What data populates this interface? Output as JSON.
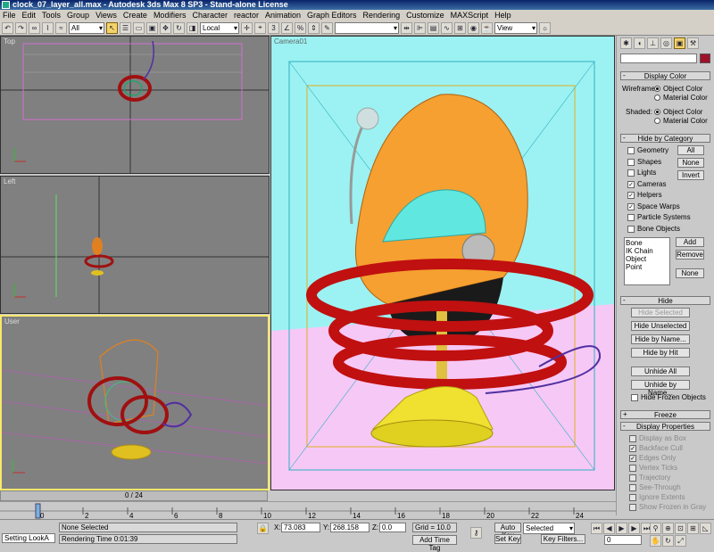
{
  "window": {
    "title": "clock_07_layer_all.max - Autodesk 3ds Max 8 SP3  - Stand-alone License"
  },
  "menu": [
    "File",
    "Edit",
    "Tools",
    "Group",
    "Views",
    "Create",
    "Modifiers",
    "Character",
    "reactor",
    "Animation",
    "Graph Editors",
    "Rendering",
    "Customize",
    "MAXScript",
    "Help"
  ],
  "toolbar": {
    "selection_filter": "All",
    "coord_system": "Local",
    "view_dropdown": "View"
  },
  "viewports": {
    "top": "Top",
    "left": "Left",
    "user": "User",
    "camera": "Camera01"
  },
  "command_panel": {
    "display_color": {
      "header": "Display Color",
      "wireframe_label": "Wireframe:",
      "shaded_label": "Shaded:",
      "object_color": "Object Color",
      "material_color": "Material Color"
    },
    "hide_by_category": {
      "header": "Hide by Category",
      "items": [
        {
          "label": "Geometry",
          "checked": false
        },
        {
          "label": "Shapes",
          "checked": false
        },
        {
          "label": "Lights",
          "checked": false
        },
        {
          "label": "Cameras",
          "checked": true
        },
        {
          "label": "Helpers",
          "checked": true
        },
        {
          "label": "Space Warps",
          "checked": true
        },
        {
          "label": "Particle Systems",
          "checked": false
        },
        {
          "label": "Bone Objects",
          "checked": false
        }
      ],
      "all": "All",
      "none": "None",
      "invert": "Invert",
      "list": [
        "Bone",
        "IK Chain Object",
        "Point"
      ],
      "add": "Add",
      "remove": "Remove",
      "none2": "None"
    },
    "hide": {
      "header": "Hide",
      "hide_selected": "Hide Selected",
      "hide_unselected": "Hide Unselected",
      "hide_by_name": "Hide by Name...",
      "hide_by_hit": "Hide by Hit",
      "unhide_all": "Unhide All",
      "unhide_by_name": "Unhide by Name...",
      "hide_frozen": "Hide Frozen Objects"
    },
    "freeze": {
      "header": "Freeze"
    },
    "display_properties": {
      "header": "Display Properties",
      "items": [
        {
          "label": "Display as Box",
          "checked": false
        },
        {
          "label": "Backface Cull",
          "checked": true
        },
        {
          "label": "Edges Only",
          "checked": true
        },
        {
          "label": "Vertex Ticks",
          "checked": false
        },
        {
          "label": "Trajectory",
          "checked": false
        },
        {
          "label": "See-Through",
          "checked": false
        },
        {
          "label": "Ignore Extents",
          "checked": false
        },
        {
          "label": "Show Frozen in Gray",
          "checked": false
        }
      ]
    }
  },
  "timeline": {
    "frame_counter": "0 / 24",
    "ticks": [
      "0",
      "2",
      "4",
      "6",
      "8",
      "10",
      "12",
      "14",
      "16",
      "18",
      "20",
      "22",
      "24"
    ]
  },
  "status": {
    "selection": "None Selected",
    "render_time": "Rendering Time  0:01:39",
    "prompt": "Setting LookA",
    "x_label": "X:",
    "x": "73.083",
    "y_label": "Y:",
    "y": "268.158",
    "z_label": "Z:",
    "z": "0.0",
    "grid": "Grid = 10.0",
    "add_time_tag": "Add Time Tag",
    "auto_key": "Auto Key",
    "set_key": "Set Key",
    "key_mode": "Selected",
    "key_filters": "Key Filters...",
    "frame": "0"
  },
  "colors": {
    "accent": "#f8e86c",
    "swatch": "#a0102a"
  }
}
